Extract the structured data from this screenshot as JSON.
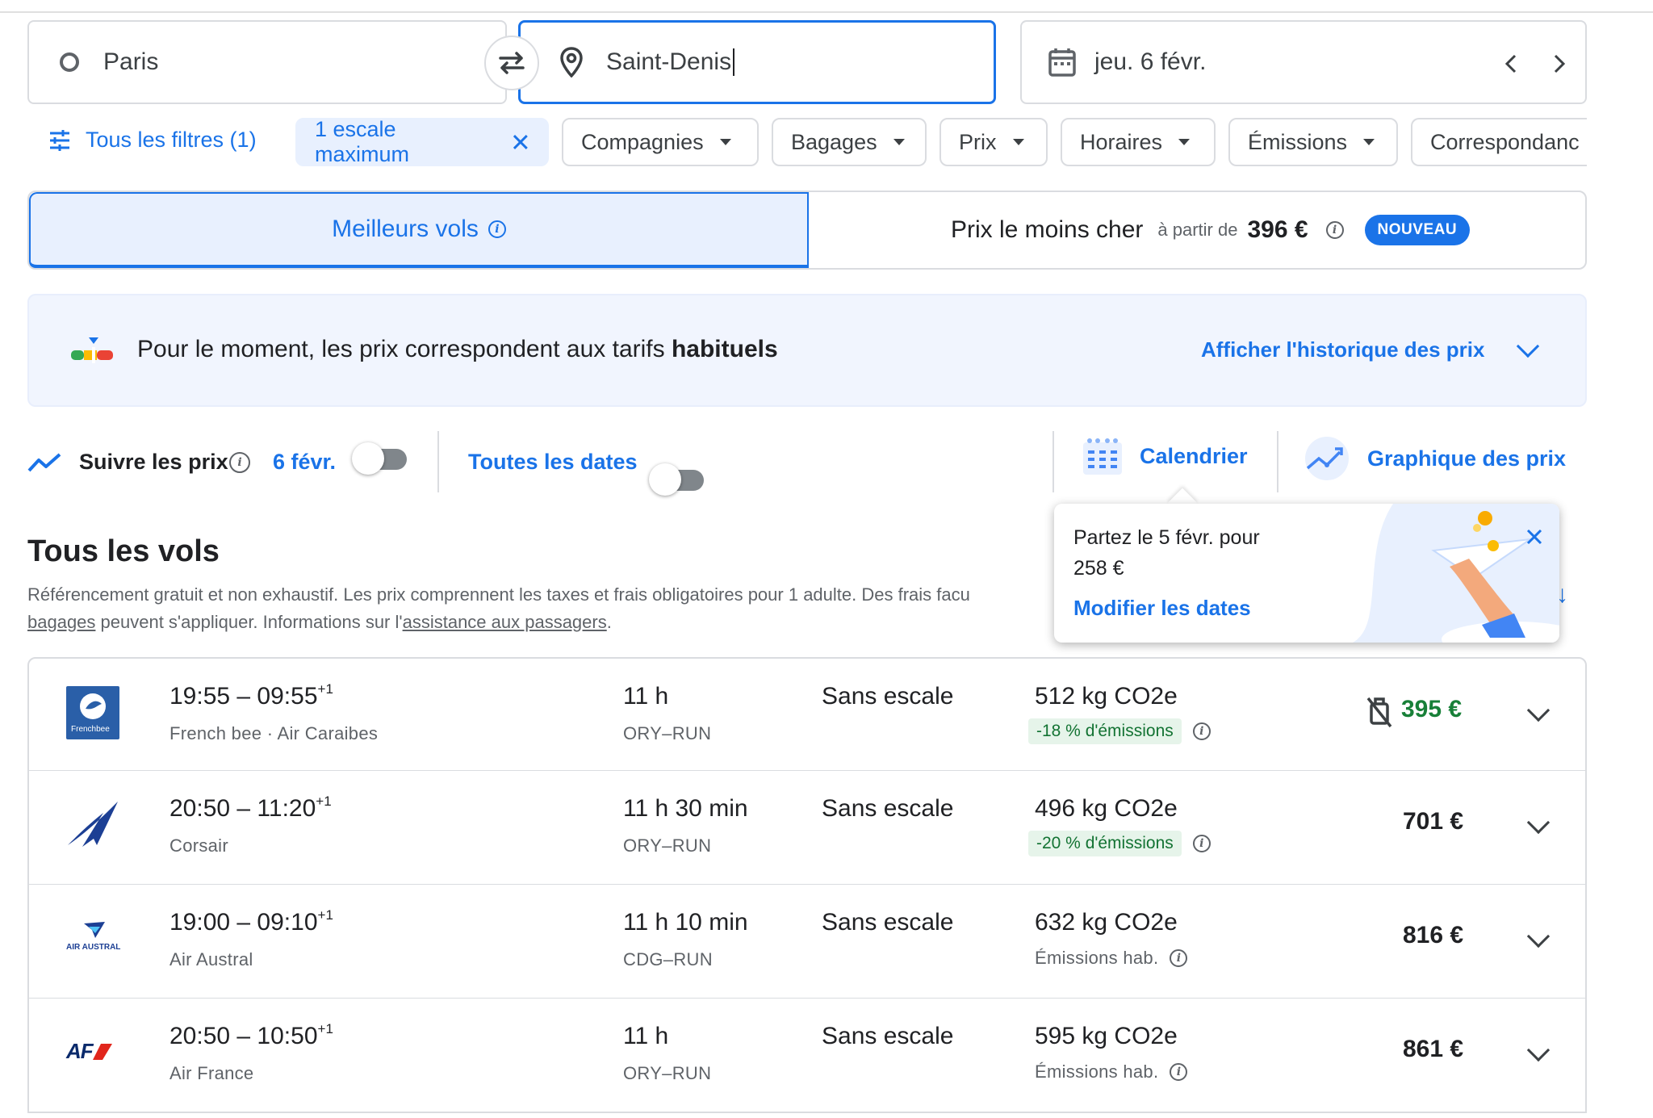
{
  "search": {
    "origin": "Paris",
    "destination": "Saint-Denis",
    "date": "jeu. 6 févr."
  },
  "filters": {
    "all_filters": "Tous les filtres (1)",
    "active_chip": "1 escale maximum",
    "chips": [
      "Compagnies",
      "Bagages",
      "Prix",
      "Horaires",
      "Émissions",
      "Correspondanc"
    ]
  },
  "tabs": {
    "best": "Meilleurs vols",
    "cheapest": "Prix le moins cher",
    "from_label": "à partir de",
    "from_price": "396 €",
    "new_badge": "NOUVEAU"
  },
  "banner": {
    "text_pre": "Pour le moment, les prix correspondent aux tarifs ",
    "text_bold": "habituels",
    "history_link": "Afficher l'historique des prix"
  },
  "tracking": {
    "label": "Suivre les prix",
    "date": "6 févr.",
    "all_dates": "Toutes les dates",
    "calendar": "Calendrier",
    "price_graph": "Graphique des prix"
  },
  "popup": {
    "line1": "Partez le 5 févr. pour",
    "line2": "258 €",
    "link": "Modifier les dates"
  },
  "results": {
    "title": "Tous les vols",
    "disclaimer1": "Référencement gratuit et non exhaustif. Les prix comprennent les taxes et frais obligatoires pour 1 adulte. Des frais facu",
    "disclaimer2_link1": "bagages",
    "disclaimer2_mid": " peuvent s'appliquer. Informations sur l'",
    "disclaimer2_link2": "assistance aux passagers",
    "disclaimer2_end": "."
  },
  "flights": [
    {
      "times": "19:55 – 09:55",
      "sup": "+1",
      "airline": "French bee · Air Caraibes",
      "duration": "11 h",
      "route": "ORY–RUN",
      "stops": "Sans escale",
      "co2": "512 kg CO2e",
      "emissions": "-18 % d'émissions",
      "emissions_type": "badge",
      "price": "395 €",
      "price_green": true,
      "logo": "frenchbee-logo"
    },
    {
      "times": "20:50 – 11:20",
      "sup": "+1",
      "airline": "Corsair",
      "duration": "11 h 30 min",
      "route": "ORY–RUN",
      "stops": "Sans escale",
      "co2": "496 kg CO2e",
      "emissions": "-20 % d'émissions",
      "emissions_type": "badge",
      "price": "701 €",
      "price_green": false,
      "logo": "corsair-logo"
    },
    {
      "times": "19:00 – 09:10",
      "sup": "+1",
      "airline": "Air Austral",
      "duration": "11 h 10 min",
      "route": "CDG–RUN",
      "stops": "Sans escale",
      "co2": "632 kg CO2e",
      "emissions": "Émissions hab.",
      "emissions_type": "text",
      "price": "816 €",
      "price_green": false,
      "logo": "airaustral-logo"
    },
    {
      "times": "20:50 – 10:50",
      "sup": "+1",
      "airline": "Air France",
      "duration": "11 h",
      "route": "ORY–RUN",
      "stops": "Sans escale",
      "co2": "595 kg CO2e",
      "emissions": "Émissions hab.",
      "emissions_type": "text",
      "price": "861 €",
      "price_green": false,
      "logo": "airfrance-logo"
    }
  ],
  "logo_text": {
    "frenchbee": "Frenchbee",
    "airaustral": "AIR AUSTRAL",
    "airfrance": "AF"
  },
  "colors": {
    "accent": "#1a73e8",
    "green_price": "#188038",
    "badge_bg": "#e6f4ea"
  }
}
